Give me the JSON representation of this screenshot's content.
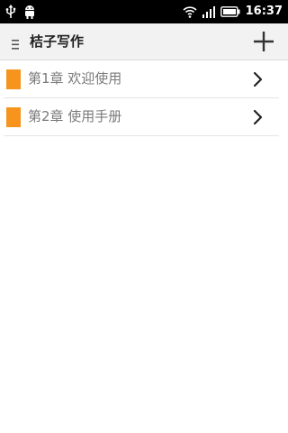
{
  "status_bar": {
    "time": "16:37",
    "icons": [
      "usb-icon",
      "android-debug-icon",
      "wifi-icon",
      "signal-icon",
      "battery-icon"
    ]
  },
  "app_bar": {
    "title": "桔子写作",
    "menu_icon": "menu-icon",
    "add_icon": "plus-icon"
  },
  "chapters": [
    {
      "title": "第1章 欢迎使用",
      "tag_color": "#f7941d"
    },
    {
      "title": "第2章 使用手册",
      "tag_color": "#f7941d"
    }
  ],
  "colors": {
    "accent": "#f7941d",
    "status_bar": "#000000",
    "app_bar": "#f2f2f2",
    "chapter_text": "#7a7a7a"
  }
}
